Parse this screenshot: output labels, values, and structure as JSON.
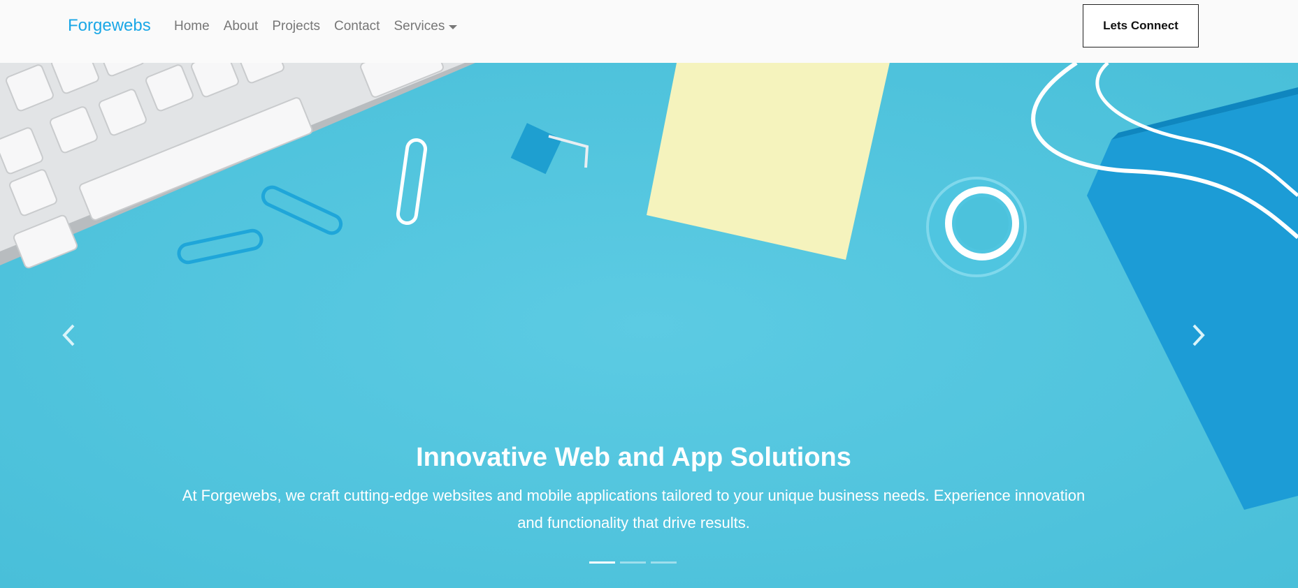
{
  "navbar": {
    "brand": "Forgewebs",
    "links": [
      "Home",
      "About",
      "Projects",
      "Contact"
    ],
    "dropdown_label": "Services",
    "cta_label": "Lets Connect"
  },
  "hero": {
    "title": "Innovative Web and App Solutions",
    "subtitle": "At Forgewebs, we craft cutting-edge websites and mobile applications tailored to your unique business needs. Experience innovation and functionality that drive results.",
    "slide_count": 3,
    "active_slide": 1,
    "colors": {
      "background": "#53c6df",
      "brand": "#1aa7e6"
    }
  },
  "icons": {
    "prev": "chevron-left-icon",
    "next": "chevron-right-icon",
    "dropdown": "caret-down-icon"
  }
}
